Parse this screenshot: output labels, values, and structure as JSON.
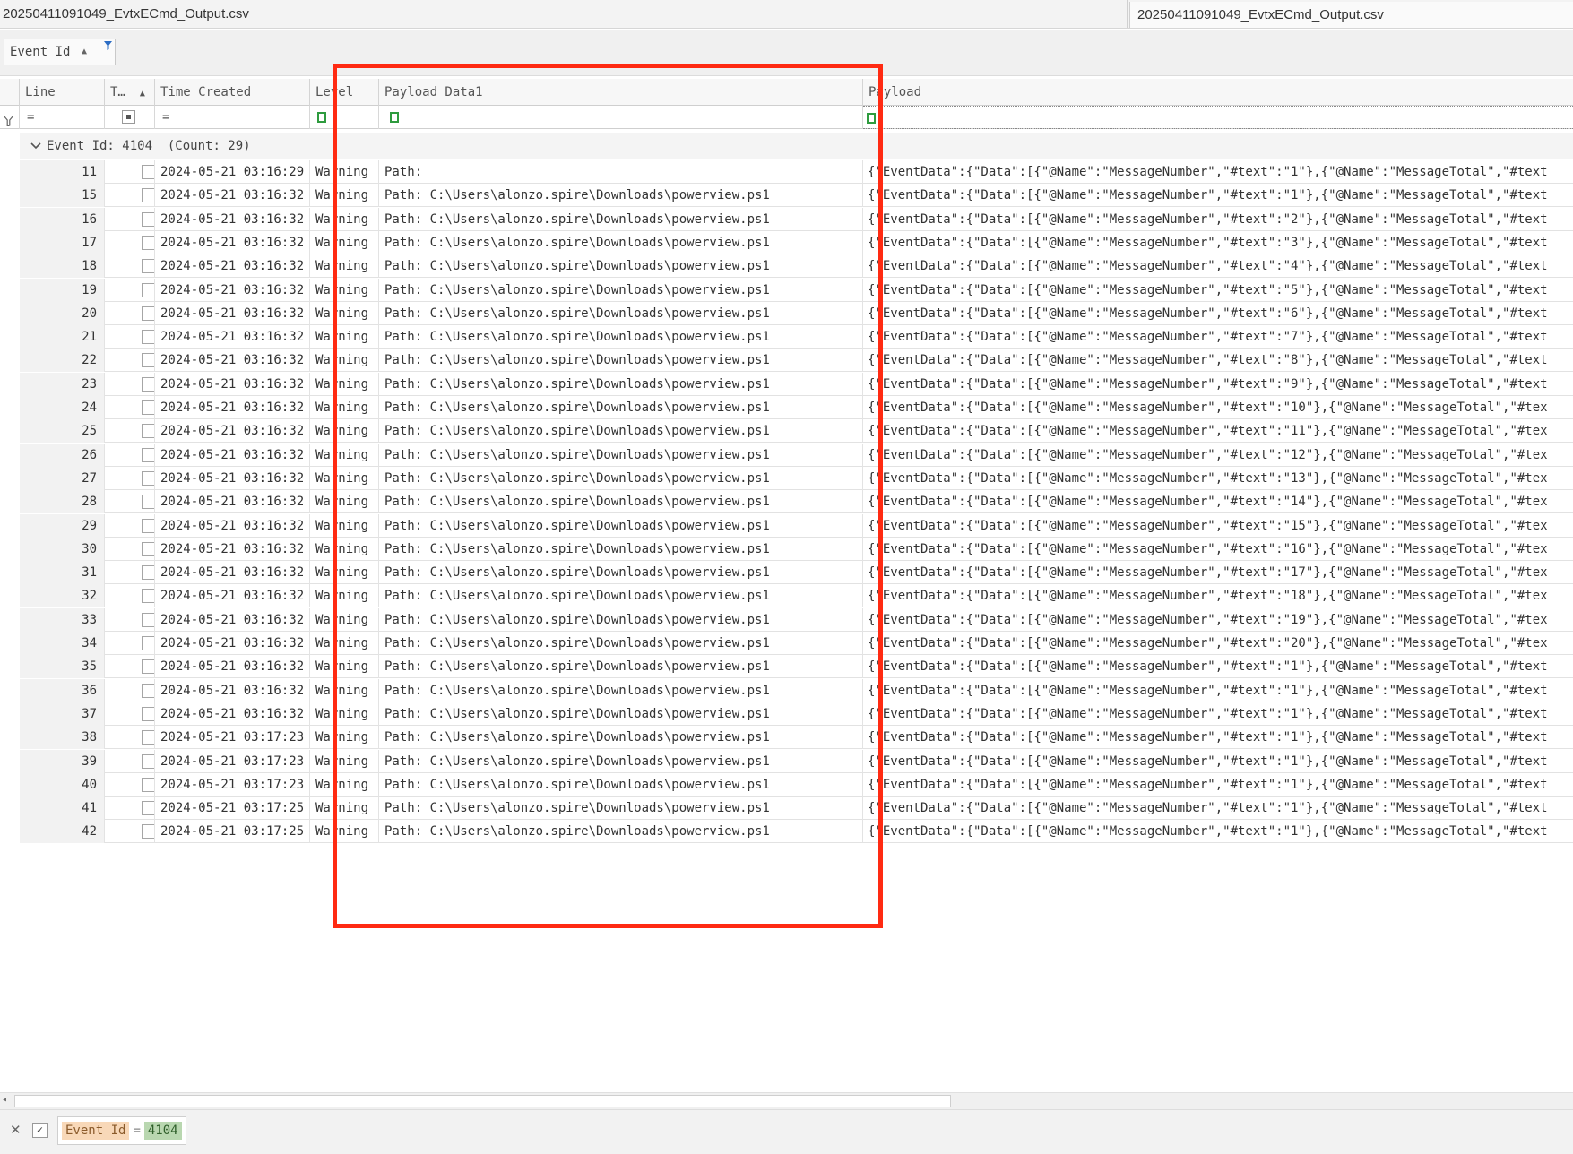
{
  "window": {
    "title_left": "20250411091049_EvtxECmd_Output.csv",
    "title_right": "20250411091049_EvtxECmd_Output.csv"
  },
  "group_panel": {
    "field_label": "Event Id",
    "sort_icon": "▲",
    "filter_icon": "funnel"
  },
  "columns": {
    "line": "Line",
    "t": "T…",
    "time_created": "Time Created",
    "level": "Level",
    "payload_data1": "Payload Data1",
    "payload": "Payload"
  },
  "filter_row": {
    "line": "=",
    "time_created": "="
  },
  "group_row": {
    "label": "Event Id: 4104",
    "count": "(Count: 29)"
  },
  "rows": [
    {
      "line": "11",
      "time": "2024-05-21 03:16:29",
      "level": "Warning",
      "pd1": "Path:",
      "payload": "{\"EventData\":{\"Data\":[{\"@Name\":\"MessageNumber\",\"#text\":\"1\"},{\"@Name\":\"MessageTotal\",\"#text"
    },
    {
      "line": "15",
      "time": "2024-05-21 03:16:32",
      "level": "Warning",
      "pd1": "Path: C:\\Users\\alonzo.spire\\Downloads\\powerview.ps1",
      "payload": "{\"EventData\":{\"Data\":[{\"@Name\":\"MessageNumber\",\"#text\":\"1\"},{\"@Name\":\"MessageTotal\",\"#text"
    },
    {
      "line": "16",
      "time": "2024-05-21 03:16:32",
      "level": "Warning",
      "pd1": "Path: C:\\Users\\alonzo.spire\\Downloads\\powerview.ps1",
      "payload": "{\"EventData\":{\"Data\":[{\"@Name\":\"MessageNumber\",\"#text\":\"2\"},{\"@Name\":\"MessageTotal\",\"#text"
    },
    {
      "line": "17",
      "time": "2024-05-21 03:16:32",
      "level": "Warning",
      "pd1": "Path: C:\\Users\\alonzo.spire\\Downloads\\powerview.ps1",
      "payload": "{\"EventData\":{\"Data\":[{\"@Name\":\"MessageNumber\",\"#text\":\"3\"},{\"@Name\":\"MessageTotal\",\"#text"
    },
    {
      "line": "18",
      "time": "2024-05-21 03:16:32",
      "level": "Warning",
      "pd1": "Path: C:\\Users\\alonzo.spire\\Downloads\\powerview.ps1",
      "payload": "{\"EventData\":{\"Data\":[{\"@Name\":\"MessageNumber\",\"#text\":\"4\"},{\"@Name\":\"MessageTotal\",\"#text"
    },
    {
      "line": "19",
      "time": "2024-05-21 03:16:32",
      "level": "Warning",
      "pd1": "Path: C:\\Users\\alonzo.spire\\Downloads\\powerview.ps1",
      "payload": "{\"EventData\":{\"Data\":[{\"@Name\":\"MessageNumber\",\"#text\":\"5\"},{\"@Name\":\"MessageTotal\",\"#text"
    },
    {
      "line": "20",
      "time": "2024-05-21 03:16:32",
      "level": "Warning",
      "pd1": "Path: C:\\Users\\alonzo.spire\\Downloads\\powerview.ps1",
      "payload": "{\"EventData\":{\"Data\":[{\"@Name\":\"MessageNumber\",\"#text\":\"6\"},{\"@Name\":\"MessageTotal\",\"#text"
    },
    {
      "line": "21",
      "time": "2024-05-21 03:16:32",
      "level": "Warning",
      "pd1": "Path: C:\\Users\\alonzo.spire\\Downloads\\powerview.ps1",
      "payload": "{\"EventData\":{\"Data\":[{\"@Name\":\"MessageNumber\",\"#text\":\"7\"},{\"@Name\":\"MessageTotal\",\"#text"
    },
    {
      "line": "22",
      "time": "2024-05-21 03:16:32",
      "level": "Warning",
      "pd1": "Path: C:\\Users\\alonzo.spire\\Downloads\\powerview.ps1",
      "payload": "{\"EventData\":{\"Data\":[{\"@Name\":\"MessageNumber\",\"#text\":\"8\"},{\"@Name\":\"MessageTotal\",\"#text"
    },
    {
      "line": "23",
      "time": "2024-05-21 03:16:32",
      "level": "Warning",
      "pd1": "Path: C:\\Users\\alonzo.spire\\Downloads\\powerview.ps1",
      "payload": "{\"EventData\":{\"Data\":[{\"@Name\":\"MessageNumber\",\"#text\":\"9\"},{\"@Name\":\"MessageTotal\",\"#text"
    },
    {
      "line": "24",
      "time": "2024-05-21 03:16:32",
      "level": "Warning",
      "pd1": "Path: C:\\Users\\alonzo.spire\\Downloads\\powerview.ps1",
      "payload": "{\"EventData\":{\"Data\":[{\"@Name\":\"MessageNumber\",\"#text\":\"10\"},{\"@Name\":\"MessageTotal\",\"#tex"
    },
    {
      "line": "25",
      "time": "2024-05-21 03:16:32",
      "level": "Warning",
      "pd1": "Path: C:\\Users\\alonzo.spire\\Downloads\\powerview.ps1",
      "payload": "{\"EventData\":{\"Data\":[{\"@Name\":\"MessageNumber\",\"#text\":\"11\"},{\"@Name\":\"MessageTotal\",\"#tex"
    },
    {
      "line": "26",
      "time": "2024-05-21 03:16:32",
      "level": "Warning",
      "pd1": "Path: C:\\Users\\alonzo.spire\\Downloads\\powerview.ps1",
      "payload": "{\"EventData\":{\"Data\":[{\"@Name\":\"MessageNumber\",\"#text\":\"12\"},{\"@Name\":\"MessageTotal\",\"#tex"
    },
    {
      "line": "27",
      "time": "2024-05-21 03:16:32",
      "level": "Warning",
      "pd1": "Path: C:\\Users\\alonzo.spire\\Downloads\\powerview.ps1",
      "payload": "{\"EventData\":{\"Data\":[{\"@Name\":\"MessageNumber\",\"#text\":\"13\"},{\"@Name\":\"MessageTotal\",\"#tex"
    },
    {
      "line": "28",
      "time": "2024-05-21 03:16:32",
      "level": "Warning",
      "pd1": "Path: C:\\Users\\alonzo.spire\\Downloads\\powerview.ps1",
      "payload": "{\"EventData\":{\"Data\":[{\"@Name\":\"MessageNumber\",\"#text\":\"14\"},{\"@Name\":\"MessageTotal\",\"#tex"
    },
    {
      "line": "29",
      "time": "2024-05-21 03:16:32",
      "level": "Warning",
      "pd1": "Path: C:\\Users\\alonzo.spire\\Downloads\\powerview.ps1",
      "payload": "{\"EventData\":{\"Data\":[{\"@Name\":\"MessageNumber\",\"#text\":\"15\"},{\"@Name\":\"MessageTotal\",\"#tex"
    },
    {
      "line": "30",
      "time": "2024-05-21 03:16:32",
      "level": "Warning",
      "pd1": "Path: C:\\Users\\alonzo.spire\\Downloads\\powerview.ps1",
      "payload": "{\"EventData\":{\"Data\":[{\"@Name\":\"MessageNumber\",\"#text\":\"16\"},{\"@Name\":\"MessageTotal\",\"#tex"
    },
    {
      "line": "31",
      "time": "2024-05-21 03:16:32",
      "level": "Warning",
      "pd1": "Path: C:\\Users\\alonzo.spire\\Downloads\\powerview.ps1",
      "payload": "{\"EventData\":{\"Data\":[{\"@Name\":\"MessageNumber\",\"#text\":\"17\"},{\"@Name\":\"MessageTotal\",\"#tex"
    },
    {
      "line": "32",
      "time": "2024-05-21 03:16:32",
      "level": "Warning",
      "pd1": "Path: C:\\Users\\alonzo.spire\\Downloads\\powerview.ps1",
      "payload": "{\"EventData\":{\"Data\":[{\"@Name\":\"MessageNumber\",\"#text\":\"18\"},{\"@Name\":\"MessageTotal\",\"#tex"
    },
    {
      "line": "33",
      "time": "2024-05-21 03:16:32",
      "level": "Warning",
      "pd1": "Path: C:\\Users\\alonzo.spire\\Downloads\\powerview.ps1",
      "payload": "{\"EventData\":{\"Data\":[{\"@Name\":\"MessageNumber\",\"#text\":\"19\"},{\"@Name\":\"MessageTotal\",\"#tex"
    },
    {
      "line": "34",
      "time": "2024-05-21 03:16:32",
      "level": "Warning",
      "pd1": "Path: C:\\Users\\alonzo.spire\\Downloads\\powerview.ps1",
      "payload": "{\"EventData\":{\"Data\":[{\"@Name\":\"MessageNumber\",\"#text\":\"20\"},{\"@Name\":\"MessageTotal\",\"#tex"
    },
    {
      "line": "35",
      "time": "2024-05-21 03:16:32",
      "level": "Warning",
      "pd1": "Path: C:\\Users\\alonzo.spire\\Downloads\\powerview.ps1",
      "payload": "{\"EventData\":{\"Data\":[{\"@Name\":\"MessageNumber\",\"#text\":\"1\"},{\"@Name\":\"MessageTotal\",\"#text"
    },
    {
      "line": "36",
      "time": "2024-05-21 03:16:32",
      "level": "Warning",
      "pd1": "Path: C:\\Users\\alonzo.spire\\Downloads\\powerview.ps1",
      "payload": "{\"EventData\":{\"Data\":[{\"@Name\":\"MessageNumber\",\"#text\":\"1\"},{\"@Name\":\"MessageTotal\",\"#text"
    },
    {
      "line": "37",
      "time": "2024-05-21 03:16:32",
      "level": "Warning",
      "pd1": "Path: C:\\Users\\alonzo.spire\\Downloads\\powerview.ps1",
      "payload": "{\"EventData\":{\"Data\":[{\"@Name\":\"MessageNumber\",\"#text\":\"1\"},{\"@Name\":\"MessageTotal\",\"#text"
    },
    {
      "line": "38",
      "time": "2024-05-21 03:17:23",
      "level": "Warning",
      "pd1": "Path: C:\\Users\\alonzo.spire\\Downloads\\powerview.ps1",
      "payload": "{\"EventData\":{\"Data\":[{\"@Name\":\"MessageNumber\",\"#text\":\"1\"},{\"@Name\":\"MessageTotal\",\"#text"
    },
    {
      "line": "39",
      "time": "2024-05-21 03:17:23",
      "level": "Warning",
      "pd1": "Path: C:\\Users\\alonzo.spire\\Downloads\\powerview.ps1",
      "payload": "{\"EventData\":{\"Data\":[{\"@Name\":\"MessageNumber\",\"#text\":\"1\"},{\"@Name\":\"MessageTotal\",\"#text"
    },
    {
      "line": "40",
      "time": "2024-05-21 03:17:23",
      "level": "Warning",
      "pd1": "Path: C:\\Users\\alonzo.spire\\Downloads\\powerview.ps1",
      "payload": "{\"EventData\":{\"Data\":[{\"@Name\":\"MessageNumber\",\"#text\":\"1\"},{\"@Name\":\"MessageTotal\",\"#text"
    },
    {
      "line": "41",
      "time": "2024-05-21 03:17:25",
      "level": "Warning",
      "pd1": "Path: C:\\Users\\alonzo.spire\\Downloads\\powerview.ps1",
      "payload": "{\"EventData\":{\"Data\":[{\"@Name\":\"MessageNumber\",\"#text\":\"1\"},{\"@Name\":\"MessageTotal\",\"#text"
    },
    {
      "line": "42",
      "time": "2024-05-21 03:17:25",
      "level": "Warning",
      "pd1": "Path: C:\\Users\\alonzo.spire\\Downloads\\powerview.ps1",
      "payload": "{\"EventData\":{\"Data\":[{\"@Name\":\"MessageNumber\",\"#text\":\"1\"},{\"@Name\":\"MessageTotal\",\"#text"
    }
  ],
  "filter_bar": {
    "field": "Event Id",
    "operator": "=",
    "value": "4104"
  },
  "colors": {
    "annotation": "#ff2a12",
    "filter_field_bg": "#f8d8b8",
    "filter_value_bg": "#b9d7b0",
    "filter_icon_green": "#2e9b3e"
  }
}
